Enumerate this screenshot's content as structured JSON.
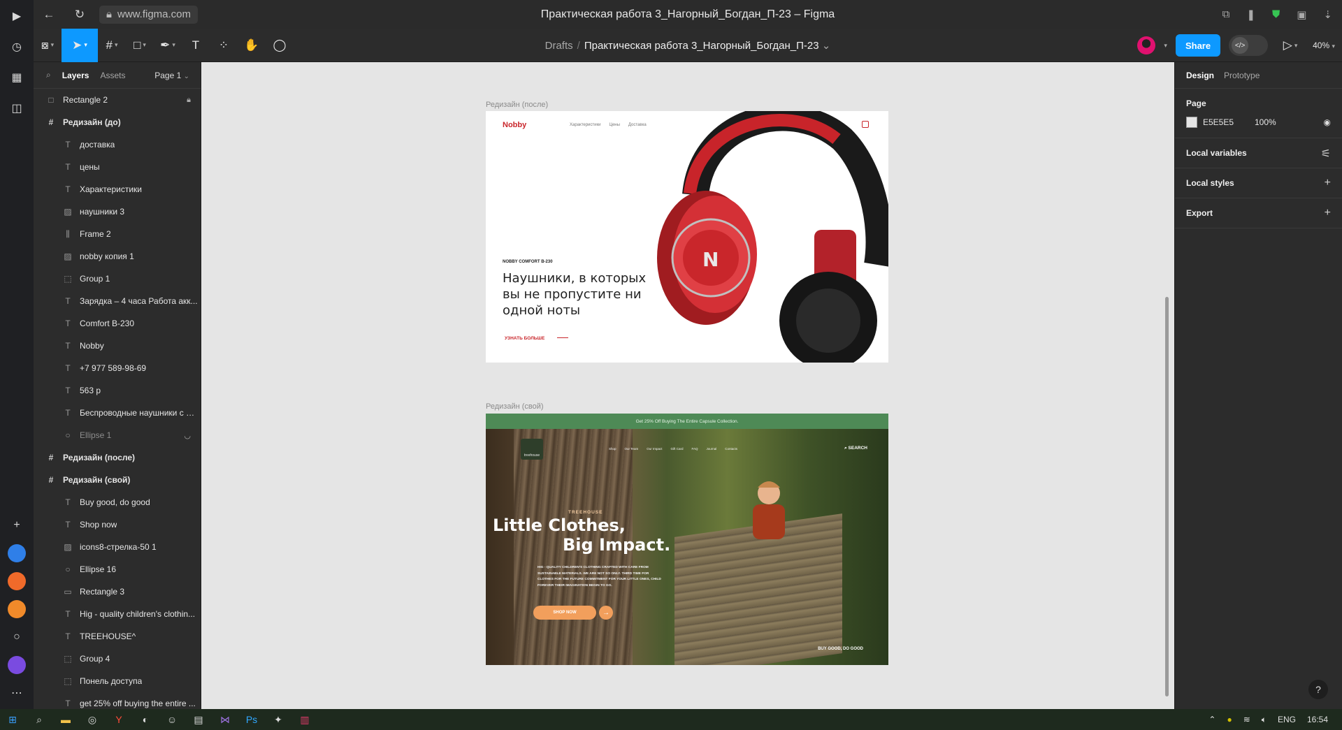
{
  "browser": {
    "url": "www.figma.com",
    "window_title": "Практическая работа 3_Нагорный_Богдан_П-23 – Figma"
  },
  "toolbar": {
    "breadcrumb_root": "Drafts",
    "breadcrumb_sep": "/",
    "file_name": "Практическая работа 3_Нагорный_Богдан_П-23",
    "share_label": "Share",
    "zoom": "40%"
  },
  "left_panel": {
    "tab_layers": "Layers",
    "tab_assets": "Assets",
    "page_selector": "Page 1",
    "layers": [
      {
        "label": "Rectangle 2",
        "icon": "rectangle-icon",
        "level": 0
      },
      {
        "label": "Редизайн (до)",
        "icon": "frame-icon",
        "level": 0,
        "frame": true
      },
      {
        "label": "доставка",
        "icon": "text-icon",
        "level": 1
      },
      {
        "label": "цены",
        "icon": "text-icon",
        "level": 1
      },
      {
        "label": "Характеристики",
        "icon": "text-icon",
        "level": 1
      },
      {
        "label": "наушники 3",
        "icon": "image-icon",
        "level": 1
      },
      {
        "label": "Frame 2",
        "icon": "autolayout-icon",
        "level": 1
      },
      {
        "label": "nobby копия 1",
        "icon": "image-icon",
        "level": 1
      },
      {
        "label": "Group 1",
        "icon": "group-icon",
        "level": 1
      },
      {
        "label": "Зарядка – 4 часа Работа акк...",
        "icon": "text-icon",
        "level": 1
      },
      {
        "label": "Comfort B-230",
        "icon": "text-icon",
        "level": 1
      },
      {
        "label": "Nobby",
        "icon": "text-icon",
        "level": 1
      },
      {
        "label": "+7 977 589-98-69",
        "icon": "text-icon",
        "level": 1
      },
      {
        "label": "563 р",
        "icon": "text-icon",
        "level": 1
      },
      {
        "label": "Беспроводные наушники с м...",
        "icon": "text-icon",
        "level": 1
      },
      {
        "label": "Ellipse 1",
        "icon": "ellipse-icon",
        "level": 1,
        "dim": true
      },
      {
        "label": "Редизайн (после)",
        "icon": "frame-icon",
        "level": 0,
        "frame": true
      },
      {
        "label": "Редизайн (свой)",
        "icon": "frame-icon",
        "level": 0,
        "frame": true
      },
      {
        "label": "Buy good, do good",
        "icon": "text-icon",
        "level": 1
      },
      {
        "label": "Shop now",
        "icon": "text-icon",
        "level": 1
      },
      {
        "label": "icons8-стрелка-50 1",
        "icon": "image-icon",
        "level": 1
      },
      {
        "label": "Ellipse 16",
        "icon": "ellipse-icon",
        "level": 1
      },
      {
        "label": "Rectangle 3",
        "icon": "line-icon",
        "level": 1
      },
      {
        "label": "Hig - quality children's clothin...",
        "icon": "text-icon",
        "level": 1
      },
      {
        "label": "TREEHOUSE^",
        "icon": "text-icon",
        "level": 1
      },
      {
        "label": "Group 4",
        "icon": "group-icon",
        "level": 1
      },
      {
        "label": "Понель доступа",
        "icon": "group-icon",
        "level": 1
      },
      {
        "label": "get 25% off buying the entire ...",
        "icon": "text-icon",
        "level": 1
      }
    ]
  },
  "canvas": {
    "frame1_label": "Редизайн  (после)",
    "frame2_label": "Редизайн  (свой)",
    "nobby": {
      "logo": "Nobby",
      "nav": [
        "Характеристики",
        "Цены",
        "Доставка"
      ],
      "model": "NOBBY COMFORT B-230",
      "heading": "Наушники, в которых вы не пропустите ни одной ноты",
      "cta": "УЗНАТЬ БОЛЬШЕ"
    },
    "treehouse": {
      "banner": "Get 25% Off Buying The Entire Capsule Collection.",
      "logo": "treehouse",
      "nav": [
        "Shop",
        "Our Team",
        "Our Impact",
        "Gift Card",
        "FAQ",
        "Journal",
        "Contacts"
      ],
      "search": "SEARCH",
      "brand": "TREEHOUSE",
      "headline1": "Little Clothes,",
      "headline2": "Big Impact.",
      "description": "HIG - QUALITY CHILDREN'S CLOTHING CRAFTED WITH CARE FROM SUSTAINABLE MATERIALS. WE ARE NOT SO ONLY. THIRD TIME FOR CLOTHES FOR THE FUTURE COMMITMENT FOR YOUR LITTLE ONES, CHILD FOREVER THEIR IMAGINATION BEGIN TO GO.",
      "shop_button": "SHOP NOW",
      "tagline": "BUY GOOD, DO GOOD"
    }
  },
  "right_panel": {
    "tab_design": "Design",
    "tab_prototype": "Prototype",
    "page_title": "Page",
    "page_color": "E5E5E5",
    "page_opacity": "100%",
    "local_variables": "Local variables",
    "local_styles": "Local styles",
    "export": "Export",
    "help": "?"
  },
  "taskbar": {
    "lang": "ENG",
    "time": "16:54"
  },
  "colors": {
    "figma_blue": "#0d99ff",
    "canvas_bg": "#e5e5e5",
    "panel_bg": "#2c2c2c",
    "nobby_red": "#c9262b",
    "treehouse_green": "#4e8a56",
    "treehouse_orange": "#f29f5c"
  }
}
